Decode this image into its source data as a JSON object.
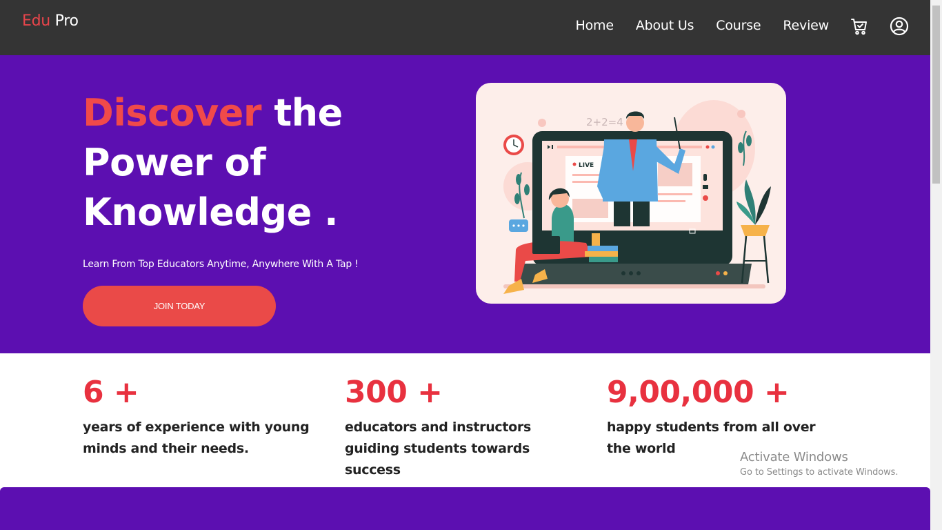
{
  "nav": {
    "logo_a": "Edu",
    "logo_b": "Pro",
    "links": [
      "Home",
      "About Us",
      "Course",
      "Review"
    ],
    "icons": [
      "cart-icon",
      "user-account-icon"
    ]
  },
  "hero": {
    "title_accent": "Discover",
    "title_line1_rest": " the",
    "title_line2": "Power of",
    "title_line3": "Knowledge .",
    "subtitle": "Learn From Top Educators Anytime, Anywhere With A Tap !",
    "cta_label": "JOIN TODAY",
    "illustration": {
      "equation": "2+2=4",
      "live_label": "LIVE"
    }
  },
  "stats": [
    {
      "number": "6 +",
      "text": "years of experience with young minds and their needs."
    },
    {
      "number": "300 +",
      "text": "educators and instructors guiding students towards success"
    },
    {
      "number": "9,00,000 +",
      "text": "happy students from all over the world"
    }
  ],
  "watermark": {
    "title": "Activate Windows",
    "subtitle": "Go to Settings to activate Windows."
  },
  "colors": {
    "nav_bg": "#343434",
    "hero_bg": "#5c0fb1",
    "accent": "#e8454b",
    "stat_number": "#e8313f"
  }
}
